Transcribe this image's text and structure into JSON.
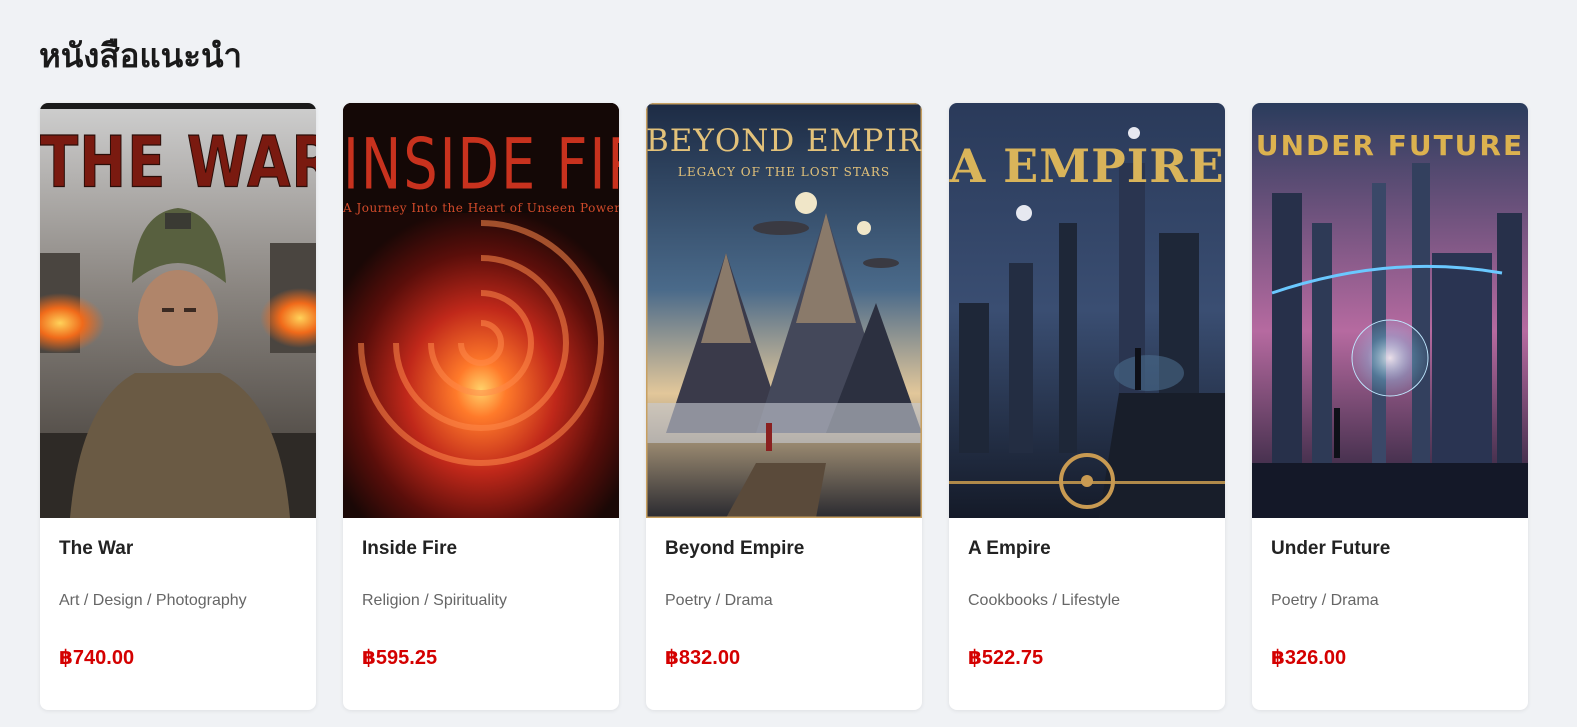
{
  "section": {
    "title": "หนังสือแนะนำ"
  },
  "books": [
    {
      "title": "The War",
      "category": "Art / Design / Photography",
      "price": "฿740.00",
      "cover_title": "THE WAR",
      "cover_subtitle": ""
    },
    {
      "title": "Inside Fire",
      "category": "Religion / Spirituality",
      "price": "฿595.25",
      "cover_title": "INSIDE FIRE",
      "cover_subtitle": "A Journey Into the Heart of Unseen Power"
    },
    {
      "title": "Beyond Empire",
      "category": "Poetry / Drama",
      "price": "฿832.00",
      "cover_title": "BEYOND EMPIRE",
      "cover_subtitle": "LEGACY OF THE LOST STARS"
    },
    {
      "title": "A Empire",
      "category": "Cookbooks / Lifestyle",
      "price": "฿522.75",
      "cover_title": "A EMPIRE",
      "cover_subtitle": ""
    },
    {
      "title": "Under Future",
      "category": "Poetry / Drama",
      "price": "฿326.00",
      "cover_title": "UNDER FUTURE",
      "cover_subtitle": ""
    }
  ],
  "colors": {
    "background": "#f0f2f5",
    "price": "#d40000",
    "category": "#666666"
  }
}
